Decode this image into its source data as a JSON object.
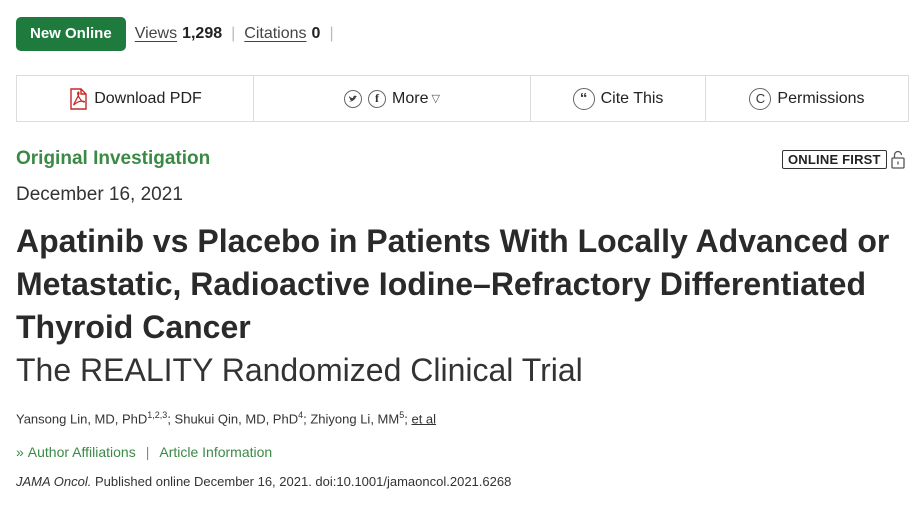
{
  "header": {
    "badge": "New Online",
    "views_label": "Views",
    "views_count": "1,298",
    "citations_label": "Citations",
    "citations_count": "0"
  },
  "toolbar": {
    "download": "Download PDF",
    "more": "More",
    "cite": "Cite This",
    "permissions": "Permissions"
  },
  "article": {
    "section": "Original Investigation",
    "online_first": "ONLINE FIRST",
    "date": "December 16, 2021",
    "title": "Apatinib vs Placebo in Patients With Locally Advanced or Metastatic, Radioactive Iodine–Refractory Differentiated Thyroid Cancer",
    "subtitle": "The REALITY Randomized Clinical Trial",
    "authors": [
      {
        "name": "Yansong Lin, MD, PhD",
        "sup": "1,2,3"
      },
      {
        "name": "Shukui Qin, MD, PhD",
        "sup": "4"
      },
      {
        "name": "Zhiyong Li, MM",
        "sup": "5"
      }
    ],
    "etal": "et al",
    "affiliations_link": "Author Affiliations",
    "info_link": "Article Information",
    "journal": "JAMA Oncol.",
    "citation": "Published online December 16, 2021. doi:10.1001/jamaoncol.2021.6268"
  }
}
